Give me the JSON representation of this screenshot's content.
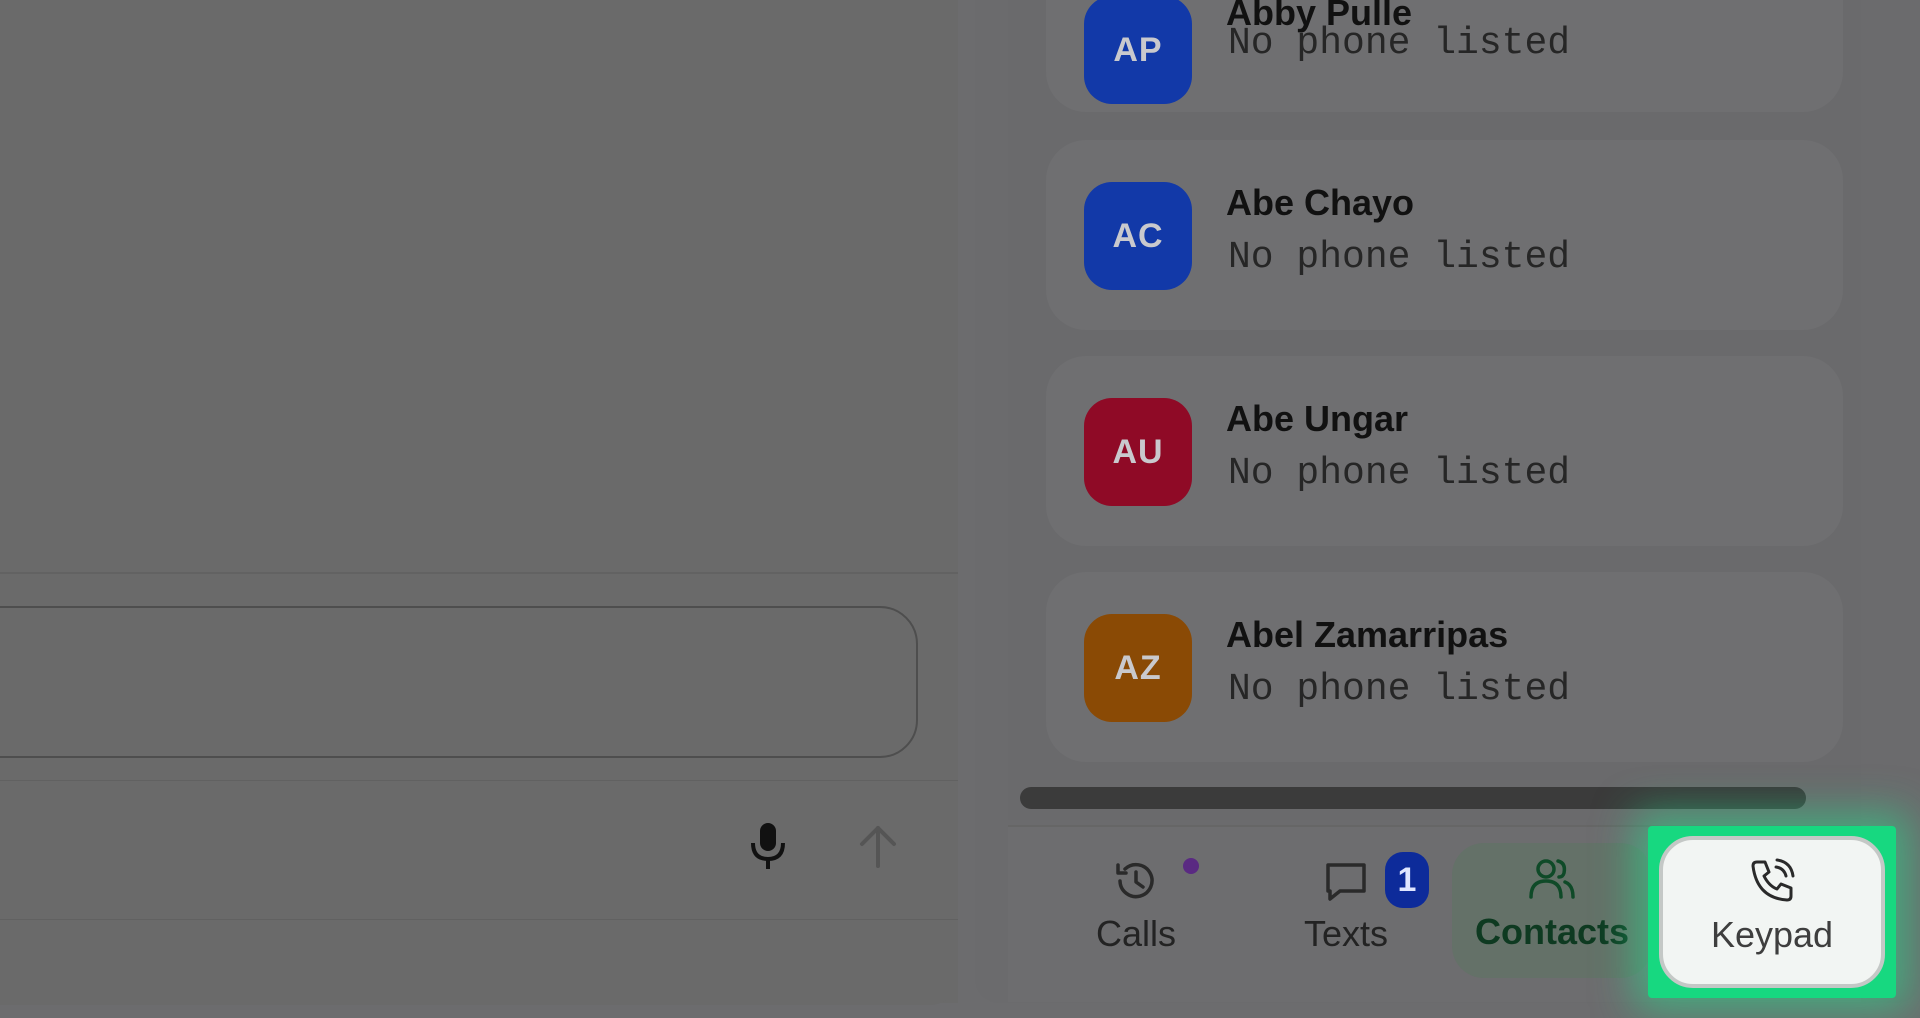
{
  "contacts": [
    {
      "initials": "AP",
      "name": "Abby Pulle",
      "phone": "No phone listed",
      "color": "#1239a8"
    },
    {
      "initials": "AC",
      "name": "Abe Chayo",
      "phone": "No phone listed",
      "color": "#1239a8"
    },
    {
      "initials": "AU",
      "name": "Abe Ungar",
      "phone": "No phone listed",
      "color": "#8f0a26"
    },
    {
      "initials": "AZ",
      "name": "Abel Zamarripas",
      "phone": "No phone listed",
      "color": "#8a4a05"
    }
  ],
  "composer": {
    "mic_icon": "microphone-icon",
    "send_icon": "arrow-up-icon"
  },
  "nav": {
    "calls": {
      "label": "Calls",
      "icon": "history-icon",
      "has_dot": true
    },
    "texts": {
      "label": "Texts",
      "icon": "message-icon",
      "badge": "1"
    },
    "contacts": {
      "label": "Contacts",
      "icon": "users-icon",
      "active": true
    },
    "keypad": {
      "label": "Keypad",
      "icon": "phone-call-icon",
      "highlighted": true
    }
  },
  "colors": {
    "highlight": "#17d880",
    "badge": "#0d2b9a",
    "calls_dot": "#5a2a82",
    "active_tab": "#0e3a21"
  }
}
